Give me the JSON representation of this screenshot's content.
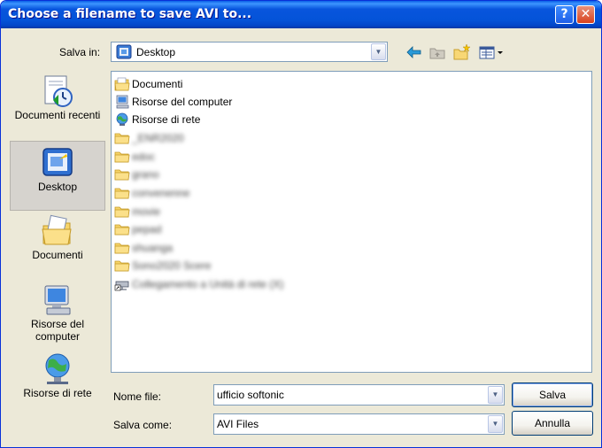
{
  "window": {
    "title": "Choose a filename to save AVI to..."
  },
  "titlebar": {
    "help_label": "?",
    "close_label": "✕"
  },
  "toolbar": {
    "save_in_label": "Salva in:",
    "location_value": "Desktop",
    "icons": [
      "back-arrow-icon",
      "up-folder-icon",
      "new-folder-icon",
      "view-menu-icon"
    ]
  },
  "places": [
    {
      "label": "Documenti recenti",
      "icon": "recent-documents-icon"
    },
    {
      "label": "Desktop",
      "icon": "desktop-icon",
      "selected": true
    },
    {
      "label": "Documenti",
      "icon": "my-documents-icon"
    },
    {
      "label": "Risorse del computer",
      "icon": "my-computer-icon"
    },
    {
      "label": "Risorse di rete",
      "icon": "network-places-icon"
    }
  ],
  "files": [
    {
      "name": "Documenti",
      "icon": "documents-folder-icon",
      "obscured": false
    },
    {
      "name": "Risorse del computer",
      "icon": "computer-icon",
      "obscured": false
    },
    {
      "name": "Risorse di rete",
      "icon": "network-icon",
      "obscured": false
    },
    {
      "name": "_ENR2020",
      "icon": "folder-icon",
      "obscured": true
    },
    {
      "name": "edoc",
      "icon": "folder-icon",
      "obscured": true
    },
    {
      "name": "grano",
      "icon": "folder-icon",
      "obscured": true
    },
    {
      "name": "convenenne",
      "icon": "folder-icon",
      "obscured": true
    },
    {
      "name": "movie",
      "icon": "folder-icon",
      "obscured": true
    },
    {
      "name": "pepad",
      "icon": "folder-icon",
      "obscured": true
    },
    {
      "name": "shuanga",
      "icon": "folder-icon",
      "obscured": true
    },
    {
      "name": "Sono2020 Scere",
      "icon": "folder-icon",
      "obscured": true
    },
    {
      "name": "Collegamento a Unità di rete (X)",
      "icon": "network-drive-shortcut-icon",
      "obscured": true
    }
  ],
  "form": {
    "filename_label": "Nome file:",
    "filename_value": "ufficio softonic",
    "type_label": "Salva come:",
    "type_value": "AVI Files"
  },
  "buttons": {
    "save": "Salva",
    "cancel": "Annulla"
  }
}
